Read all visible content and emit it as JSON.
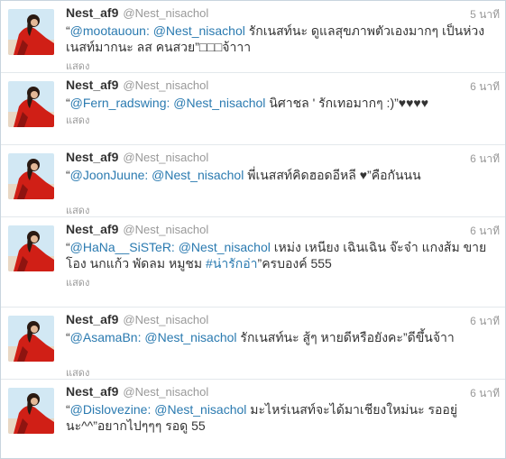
{
  "colors": {
    "link": "#2a7ab0",
    "text": "#333333",
    "muted": "#999999"
  },
  "tweets": [
    {
      "name": "Nest_af9",
      "handle": "@Nest_nisachol",
      "time": "5 นาที",
      "open_quote": "“",
      "rt_user": "@mootauoun:",
      "mention": "@Nest_nisachol",
      "body": " รักเนสท์นะ ดูแลสุขภาพตัวเองมากๆ เป็นห่วงเนสท์มากนะ ลส คนสวย”□□□จ้าาา",
      "expand": "แสดง"
    },
    {
      "name": "Nest_af9",
      "handle": "@Nest_nisachol",
      "time": "6 นาที",
      "open_quote": "“",
      "rt_user": "@Fern_radswing:",
      "mention": "@Nest_nisachol",
      "body": " นิศาชล ' รักเทอมากๆ :)”♥♥♥♥",
      "expand": "แสดง"
    },
    {
      "name": "Nest_af9",
      "handle": "@Nest_nisachol",
      "time": "6 นาที",
      "open_quote": "“",
      "rt_user": "@JoonJuune:",
      "mention": "@Nest_nisachol",
      "body": " พี่เนสสท์คิดฮอดอีหลี ♥”คือกันนน",
      "expand": "แสดง"
    },
    {
      "name": "Nest_af9",
      "handle": "@Nest_nisachol",
      "time": "6 นาที",
      "open_quote": "“",
      "rt_user": "@HaNa__SiSTeR:",
      "mention": "@Nest_nisachol",
      "body": " เหม่ง เหนียง เฉินเฉิน จ๊ะจ๋า แกงส้ม ขายโอง นกแก้ว พัดลม หมูชม ",
      "hashtag": "#น่ารักอ่า",
      "after": "”ครบองค์ 555",
      "expand": "แสดง"
    },
    {
      "name": "Nest_af9",
      "handle": "@Nest_nisachol",
      "time": "6 นาที",
      "open_quote": "“",
      "rt_user": "@AsamaBn:",
      "mention": "@Nest_nisachol",
      "body": " รักเนสท์นะ สู้ๆ หายดีหรือยังคะ”ดีขึ้นจ้าา",
      "expand": "แสดง"
    },
    {
      "name": "Nest_af9",
      "handle": "@Nest_nisachol",
      "time": "6 นาที",
      "open_quote": "“",
      "rt_user": "@Dislovezine:",
      "mention": "@Nest_nisachol",
      "body": " มะไหร่เนสท์จะได้มาเชียงใหม่นะ รออยู่นะ^^”อยากไปๆๆๆ รอดู 55",
      "expand": ""
    }
  ]
}
